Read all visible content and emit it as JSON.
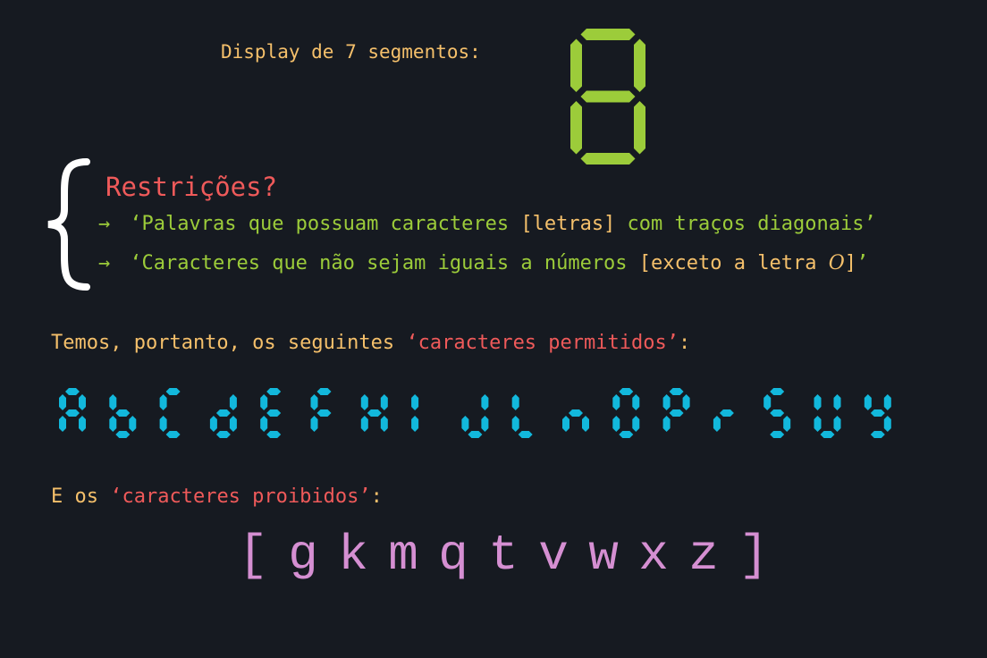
{
  "display_label": "Display de 7 segmentos:",
  "digit_color": "#9ccc3a",
  "allowed_color": "#12b8dc",
  "restrictions": {
    "title": "Restrições?",
    "rules": [
      {
        "arrow": "→",
        "open_quote": "‘",
        "text_before": "Palavras que possuam caracteres ",
        "highlight": "[letras]",
        "text_after": " com traços diagonais",
        "close_quote": "’"
      },
      {
        "arrow": "→",
        "open_quote": "‘",
        "text_before": "Caracteres que não sejam iguais a números ",
        "highlight": "[exceto a letra ",
        "highlight_italic": "O",
        "highlight_end": "]",
        "close_quote": "’"
      }
    ]
  },
  "allowed_intro": {
    "before": "Temos, portanto, os seguintes ",
    "quoted": "‘caracteres permitidos’",
    "after": ":"
  },
  "allowed_characters": [
    "A",
    "b",
    "C",
    "d",
    "E",
    "F",
    "H",
    "I",
    "J",
    "L",
    "n",
    "O",
    "P",
    "r",
    "S",
    "U",
    "Y"
  ],
  "forbidden_intro": {
    "before": "E os ",
    "quoted": "‘caracteres proibidos’",
    "after": ":"
  },
  "forbidden_characters": [
    "[",
    "g",
    "k",
    "m",
    "q",
    "t",
    "v",
    "w",
    "x",
    "z",
    "]"
  ]
}
